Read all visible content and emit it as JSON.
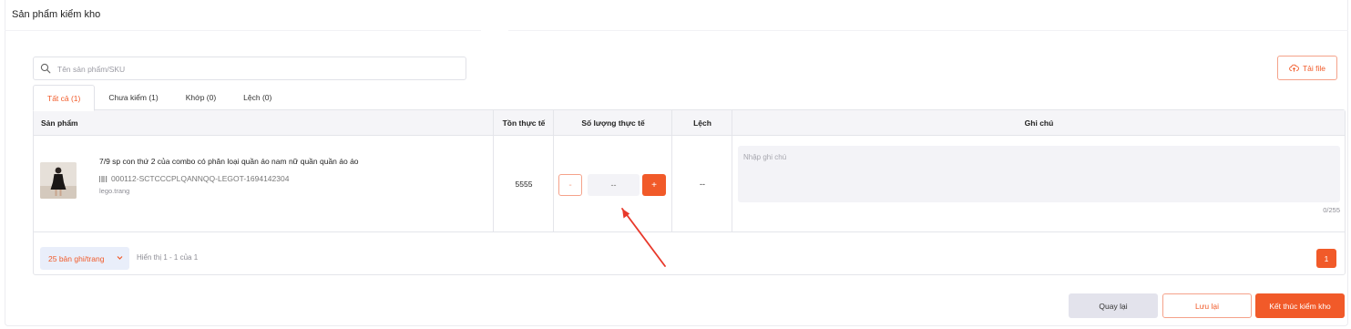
{
  "page": {
    "title": "Sản phẩm kiểm kho"
  },
  "search": {
    "placeholder": "Tên sản phẩm/SKU"
  },
  "upload": {
    "label": "Tải file"
  },
  "tabs": [
    {
      "label": "Tất cả (1)",
      "active": true
    },
    {
      "label": "Chưa kiểm (1)",
      "active": false
    },
    {
      "label": "Khớp (0)",
      "active": false
    },
    {
      "label": "Lệch (0)",
      "active": false
    }
  ],
  "table": {
    "headers": {
      "product": "Sản phẩm",
      "actual_stock": "Tồn thực tế",
      "actual_quantity": "Số lượng thực tế",
      "difference": "Lệch",
      "note": "Ghi chú"
    },
    "rows": [
      {
        "name": "7/9 sp con thứ 2 của combo có phân loại quần áo nam nữ quần quần áo áo",
        "sku": "000112-SCTCCCPLQANNQQ-LEGOT-1694142304",
        "shop": "lego.trang",
        "actual_stock": "5555",
        "minus": "-",
        "quantity_placeholder": "--",
        "plus": "+",
        "difference": "--",
        "note_placeholder": "Nhập ghi chú",
        "note_counter": "0/255"
      }
    ]
  },
  "pagination": {
    "page_size": "25 bản ghi/trang",
    "showing": "Hiển thị 1 - 1 của 1",
    "current_page": "1"
  },
  "actions": {
    "back": "Quay lại",
    "save": "Lưu lại",
    "finish": "Kết thúc kiểm kho"
  },
  "colors": {
    "accent": "#f15a29",
    "accent_light": "#f5a28a",
    "annotation_arrow": "#e8382a"
  }
}
